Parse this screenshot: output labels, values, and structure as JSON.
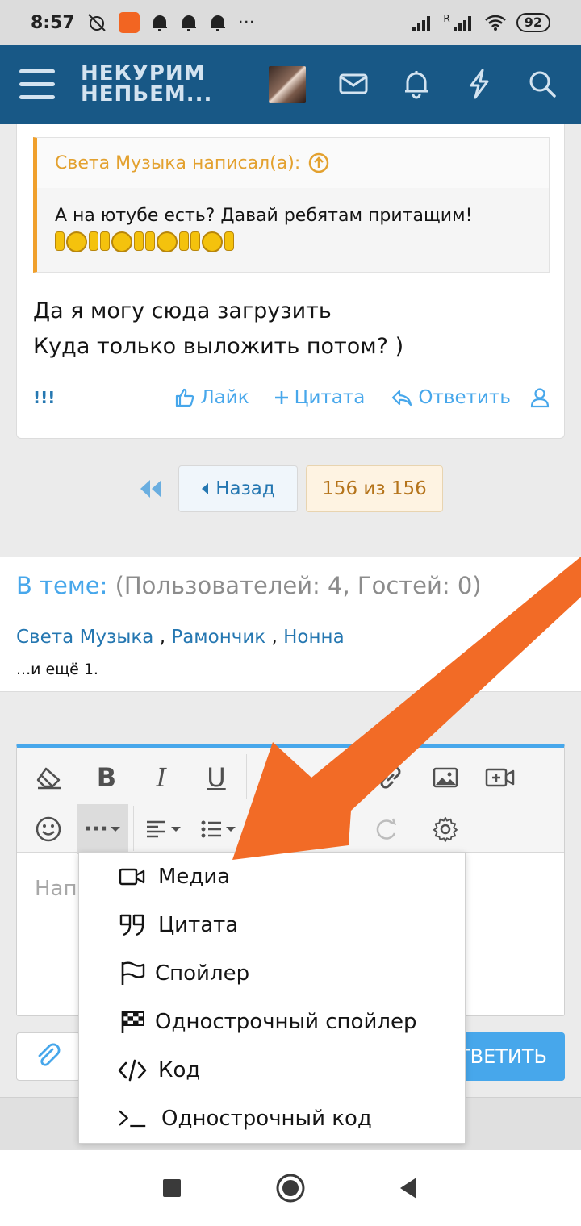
{
  "status_bar": {
    "time": "8:57",
    "dots": "···",
    "signal1_label": "R",
    "battery": "92"
  },
  "header": {
    "logo_line1": "НЕКУРИМ",
    "logo_line2": "НЕПЬЕМ...",
    "icons": [
      "mail-icon",
      "bell-icon",
      "bolt-icon",
      "search-icon"
    ]
  },
  "post": {
    "quote_author": "Света Музыка написал(а):",
    "quote_text": "А на ютубе есть? Давай ребятам притащим!",
    "body_line1": "Да я могу сюда загрузить",
    "body_line2": "Куда только выложить потом? )",
    "actions": {
      "report": "!!!",
      "like": "Лайк",
      "quote": "Цитата",
      "reply": "Ответить"
    }
  },
  "pagination": {
    "back": "Назад",
    "current": "156 из 156"
  },
  "online": {
    "label": "В теме:",
    "counts": "(Пользователей: 4, Гостей: 0)",
    "users": [
      "Света Музыка",
      "Рамончик",
      "Нонна"
    ],
    "separator": ",",
    "more": "...и ещё 1."
  },
  "editor": {
    "placeholder": "Нап",
    "toolbar": {
      "bold": "B",
      "italic": "I",
      "underline": "U",
      "more": "···"
    }
  },
  "menu": {
    "items": [
      {
        "label": "Медиа",
        "icon": "video-icon"
      },
      {
        "label": "Цитата",
        "icon": "quote-icon"
      },
      {
        "label": "Спойлер",
        "icon": "flag-icon"
      },
      {
        "label": "Однострочный спойлер",
        "icon": "checkered-flag-icon"
      },
      {
        "label": "Код",
        "icon": "code-icon"
      },
      {
        "label": "Однострочный код",
        "icon": "terminal-icon"
      }
    ]
  },
  "reply_button": "ОТВЕТИТЬ",
  "colors": {
    "header_bg": "#185886",
    "accent_blue": "#47a7eb",
    "link_blue": "#2577b1",
    "quote_orange": "#f0a02c",
    "arrow_orange": "#f26b26"
  }
}
